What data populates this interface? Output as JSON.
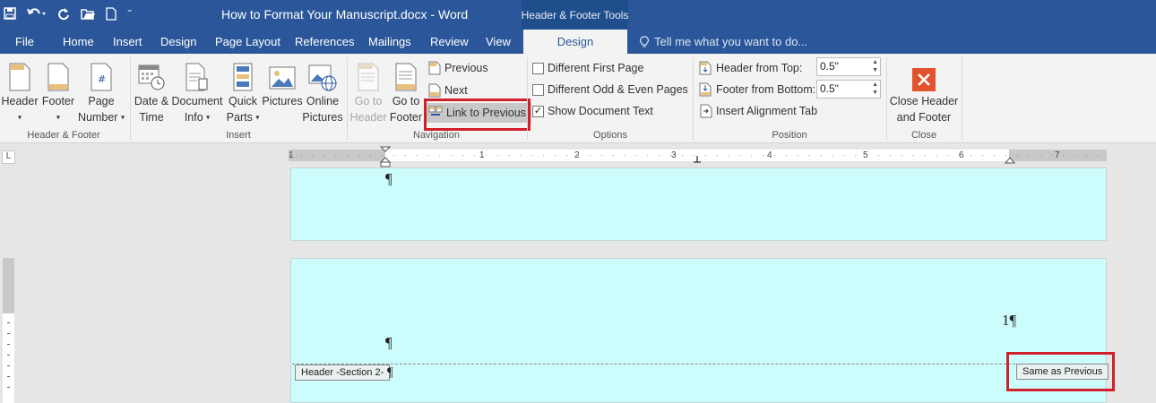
{
  "title_bar": {
    "document_title": "How to Format Your Manuscript.docx - Word",
    "context_tools": "Header & Footer Tools",
    "qat_icons": [
      "save-icon",
      "undo-icon",
      "redo-icon",
      "open-icon",
      "new-icon",
      "customize-icon"
    ]
  },
  "tabs": {
    "file": "File",
    "home": "Home",
    "insert": "Insert",
    "design": "Design",
    "page_layout": "Page Layout",
    "references": "References",
    "mailings": "Mailings",
    "review": "Review",
    "view": "View",
    "hf_design": "Design",
    "tell_me": "Tell me what you want to do..."
  },
  "ribbon": {
    "header_footer": {
      "label": "Header & Footer",
      "header": "Header",
      "footer": "Footer",
      "page": "Page",
      "number": "Number"
    },
    "insert": {
      "label": "Insert",
      "date1": "Date &",
      "date2": "Time",
      "doc1": "Document",
      "doc2": "Info",
      "quick1": "Quick",
      "quick2": "Parts",
      "pictures": "Pictures",
      "online1": "Online",
      "online2": "Pictures"
    },
    "navigation": {
      "label": "Navigation",
      "goto_header1": "Go to",
      "goto_header2": "Header",
      "goto_footer1": "Go to",
      "goto_footer2": "Footer",
      "previous": "Previous",
      "next": "Next",
      "link_to_previous": "Link to Previous"
    },
    "options": {
      "label": "Options",
      "different_first_page": "Different First Page",
      "different_odd_even": "Different Odd & Even Pages",
      "show_document_text": "Show Document Text",
      "different_first_page_checked": false,
      "different_odd_even_checked": false,
      "show_document_text_checked": true
    },
    "position": {
      "label": "Position",
      "header_from_top": "Header from Top:",
      "header_from_top_value": "0.5\"",
      "footer_from_bottom": "Footer from Bottom:",
      "footer_from_bottom_value": "0.5\"",
      "insert_alignment_tab": "Insert Alignment Tab"
    },
    "close": {
      "label": "Close",
      "close1": "Close Header",
      "close2": "and Footer"
    }
  },
  "ruler": {
    "numbers": [
      "1",
      "1",
      "2",
      "3",
      "4",
      "5",
      "6",
      "7"
    ],
    "corner": "L"
  },
  "document": {
    "pilcrow": "¶",
    "page_number": "1¶",
    "header_section_tag": "Header -Section 2-",
    "same_as_previous_tag": "Same as Previous"
  },
  "colors": {
    "word_blue": "#2b579a",
    "page_fill": "#ccfcfc",
    "highlight": "#d0202c",
    "close_red": "#e2532d"
  }
}
